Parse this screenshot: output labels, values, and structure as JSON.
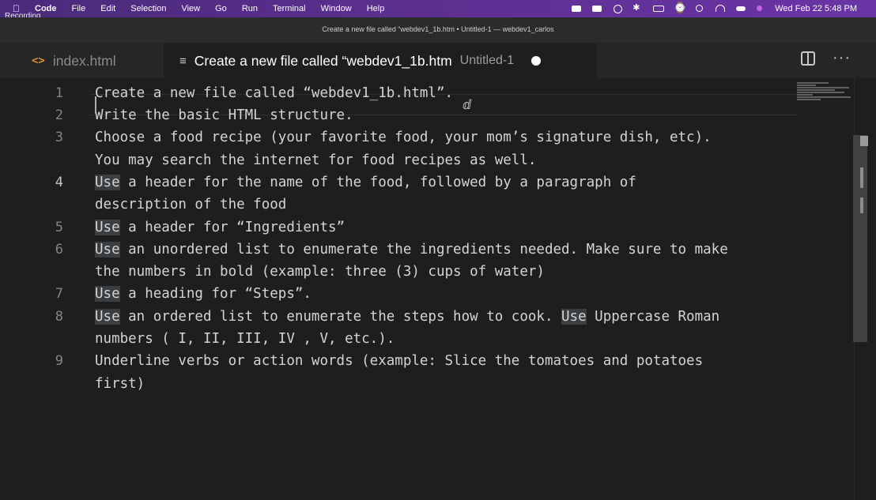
{
  "menubar": {
    "items": [
      "Code",
      "File",
      "Edit",
      "Selection",
      "View",
      "Go",
      "Run",
      "Terminal",
      "Window",
      "Help"
    ],
    "clock": "Wed Feb 22  5:48 PM"
  },
  "overlay": {
    "recording": "Recording"
  },
  "window": {
    "title": "Create a new file called “webdev1_1b.htm • Untitled-1 — webdev1_carlos"
  },
  "tabs": [
    {
      "label": "index.html",
      "icon": "html-code-icon"
    },
    {
      "label": "Create a new file called “webdev1_1b.htm",
      "description": "Untitled-1",
      "icon": "text-file-icon",
      "dirty": true
    }
  ],
  "editor": {
    "active_line": 4,
    "line_numbers": [
      "1",
      "2",
      "3",
      "4",
      "5",
      "6",
      "7",
      "8",
      "9"
    ],
    "lines": [
      [
        "Create a new file called “webdev1_1b.html”."
      ],
      [
        "Write the basic HTML structure."
      ],
      [
        "Choose a food recipe (your favorite food, your mom’s signature dish, etc).",
        "You may search the internet for food recipes as well."
      ],
      [
        "Use a header for the name of the food, followed by a paragraph of",
        "description of the food"
      ],
      [
        "Use a header for “Ingredients”"
      ],
      [
        "Use an unordered list to enumerate the ingredients needed. Make sure to make",
        "the numbers in bold (example: three (3) cups of water)"
      ],
      [
        "Use a heading for “Steps”."
      ],
      [
        "Use an ordered list to enumerate the steps how to cook. Use Uppercase Roman",
        "numbers ( I, II, III, IV , V, etc.)."
      ],
      [
        "Underline verbs or action words (example: Slice the tomatoes and potatoes",
        "first)"
      ]
    ]
  }
}
